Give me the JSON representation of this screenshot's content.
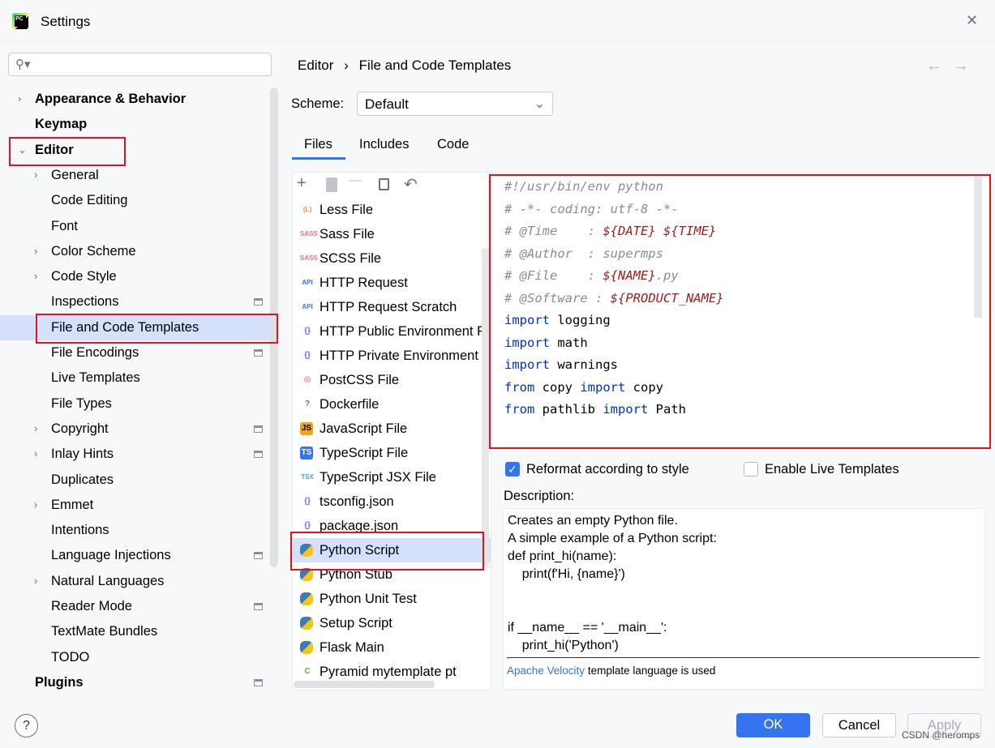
{
  "window": {
    "title": "Settings",
    "close": "✕"
  },
  "search": {
    "placeholder": ""
  },
  "sidebar": {
    "items": [
      {
        "label": "Appearance & Behavior",
        "level": 0,
        "chevron": true
      },
      {
        "label": "Keymap",
        "level": 0
      },
      {
        "label": "Editor",
        "level": 0,
        "expanded": true
      },
      {
        "label": "General",
        "level": 1,
        "chevron": true
      },
      {
        "label": "Code Editing",
        "level": 1
      },
      {
        "label": "Font",
        "level": 1
      },
      {
        "label": "Color Scheme",
        "level": 1,
        "chevron": true
      },
      {
        "label": "Code Style",
        "level": 1,
        "chevron": true
      },
      {
        "label": "Inspections",
        "level": 1,
        "gear": true
      },
      {
        "label": "File and Code Templates",
        "level": 1,
        "selected": true
      },
      {
        "label": "File Encodings",
        "level": 1,
        "gear": true
      },
      {
        "label": "Live Templates",
        "level": 1
      },
      {
        "label": "File Types",
        "level": 1
      },
      {
        "label": "Copyright",
        "level": 1,
        "chevron": true,
        "gear": true
      },
      {
        "label": "Inlay Hints",
        "level": 1,
        "chevron": true,
        "gear": true
      },
      {
        "label": "Duplicates",
        "level": 1
      },
      {
        "label": "Emmet",
        "level": 1,
        "chevron": true
      },
      {
        "label": "Intentions",
        "level": 1
      },
      {
        "label": "Language Injections",
        "level": 1,
        "gear": true
      },
      {
        "label": "Natural Languages",
        "level": 1,
        "chevron": true
      },
      {
        "label": "Reader Mode",
        "level": 1,
        "gear": true
      },
      {
        "label": "TextMate Bundles",
        "level": 1
      },
      {
        "label": "TODO",
        "level": 1
      },
      {
        "label": "Plugins",
        "level": 0,
        "gear": true
      }
    ]
  },
  "breadcrumb": {
    "parent": "Editor",
    "separator": "›",
    "current": "File and Code Templates"
  },
  "nav": {
    "back": "←",
    "forward": "→"
  },
  "scheme": {
    "label": "Scheme:",
    "value": "Default"
  },
  "tabs": [
    {
      "label": "Files",
      "active": true
    },
    {
      "label": "Includes"
    },
    {
      "label": "Code"
    }
  ],
  "toolbar": {
    "add": "+",
    "remove": "—",
    "undo": "↶"
  },
  "templates": [
    {
      "label": "Less File",
      "icon": "{L}",
      "color": "#f08d5b"
    },
    {
      "label": "Sass File",
      "icon": "SASS",
      "color": "#e86d96"
    },
    {
      "label": "SCSS File",
      "icon": "SASS",
      "color": "#e86d96"
    },
    {
      "label": "HTTP Request",
      "icon": "API",
      "color": "#3574f0"
    },
    {
      "label": "HTTP Request Scratch",
      "icon": "API",
      "color": "#3574f0"
    },
    {
      "label": "HTTP Public Environment File",
      "icon": "{}",
      "color": "#8f5cf0"
    },
    {
      "label": "HTTP Private Environment File",
      "icon": "{}",
      "color": "#8f5cf0"
    },
    {
      "label": "PostCSS File",
      "icon": "◎",
      "color": "#e0533c"
    },
    {
      "label": "Dockerfile",
      "icon": "?",
      "color": "#6c707e"
    },
    {
      "label": "JavaScript File",
      "icon": "JS",
      "color": "#f2a50c"
    },
    {
      "label": "TypeScript File",
      "icon": "TS",
      "color": "#3574f0"
    },
    {
      "label": "TypeScript JSX File",
      "icon": "TSX",
      "color": "#3fa7c5"
    },
    {
      "label": "tsconfig.json",
      "icon": "{}",
      "color": "#8f5cf0"
    },
    {
      "label": "package.json",
      "icon": "{}",
      "color": "#8f5cf0"
    },
    {
      "label": "Python Script",
      "icon": "py",
      "color": "#3d7ab8",
      "selected": true
    },
    {
      "label": "Python Stub",
      "icon": "py",
      "color": "#3d7ab8"
    },
    {
      "label": "Python Unit Test",
      "icon": "py",
      "color": "#3d7ab8"
    },
    {
      "label": "Setup Script",
      "icon": "py",
      "color": "#3d7ab8"
    },
    {
      "label": "Flask Main",
      "icon": "py",
      "color": "#3d7ab8"
    },
    {
      "label": "Pyramid mytemplate pt",
      "icon": "C",
      "color": "#62b543"
    }
  ],
  "editor": {
    "lines": [
      [
        {
          "t": "#!/usr/bin/env python",
          "c": "cm"
        }
      ],
      [
        {
          "t": "# -*- coding: utf-8 -*-",
          "c": "cm"
        }
      ],
      [
        {
          "t": "# @Time    : ",
          "c": "cm"
        },
        {
          "t": "${DATE}",
          "c": "var"
        },
        {
          "t": " ",
          "c": "cm"
        },
        {
          "t": "${TIME}",
          "c": "var"
        }
      ],
      [
        {
          "t": "# @Author  : supermps",
          "c": "cm"
        }
      ],
      [
        {
          "t": "# @File    : ",
          "c": "cm"
        },
        {
          "t": "${NAME}",
          "c": "var"
        },
        {
          "t": ".py",
          "c": "cm"
        }
      ],
      [
        {
          "t": "# @Software : ",
          "c": "cm"
        },
        {
          "t": "${PRODUCT_NAME}",
          "c": "var"
        }
      ],
      [
        {
          "t": "import",
          "c": "kw"
        },
        {
          "t": " logging",
          "c": ""
        }
      ],
      [
        {
          "t": "import",
          "c": "kw"
        },
        {
          "t": " math",
          "c": ""
        }
      ],
      [
        {
          "t": "import",
          "c": "kw"
        },
        {
          "t": " warnings",
          "c": ""
        }
      ],
      [
        {
          "t": "from",
          "c": "kw"
        },
        {
          "t": " copy ",
          "c": ""
        },
        {
          "t": "import",
          "c": "kw"
        },
        {
          "t": " copy",
          "c": ""
        }
      ],
      [
        {
          "t": "from",
          "c": "kw"
        },
        {
          "t": " pathlib ",
          "c": ""
        },
        {
          "t": "import",
          "c": "kw"
        },
        {
          "t": " Path",
          "c": ""
        }
      ]
    ]
  },
  "options": {
    "reformat": {
      "label": "Reformat according to style",
      "checked": true
    },
    "live_templates": {
      "label": "Enable Live Templates",
      "checked": false
    }
  },
  "description": {
    "label": "Description:",
    "text": "Creates an empty Python file.\nA simple example of a Python script:\ndef print_hi(name):\n    print(f'Hi, {name}')\n\n\nif __name__ == '__main__':\n    print_hi('Python')",
    "link": "Apache Velocity",
    "link_suffix": "template language is used"
  },
  "footer": {
    "help": "?",
    "ok": "OK",
    "cancel": "Cancel",
    "apply": "Apply"
  },
  "watermark": "CSDN @heromps",
  "colors": {
    "accent": "#3574f0",
    "selection": "#d5e1fb",
    "highlight": "#e3121e"
  }
}
